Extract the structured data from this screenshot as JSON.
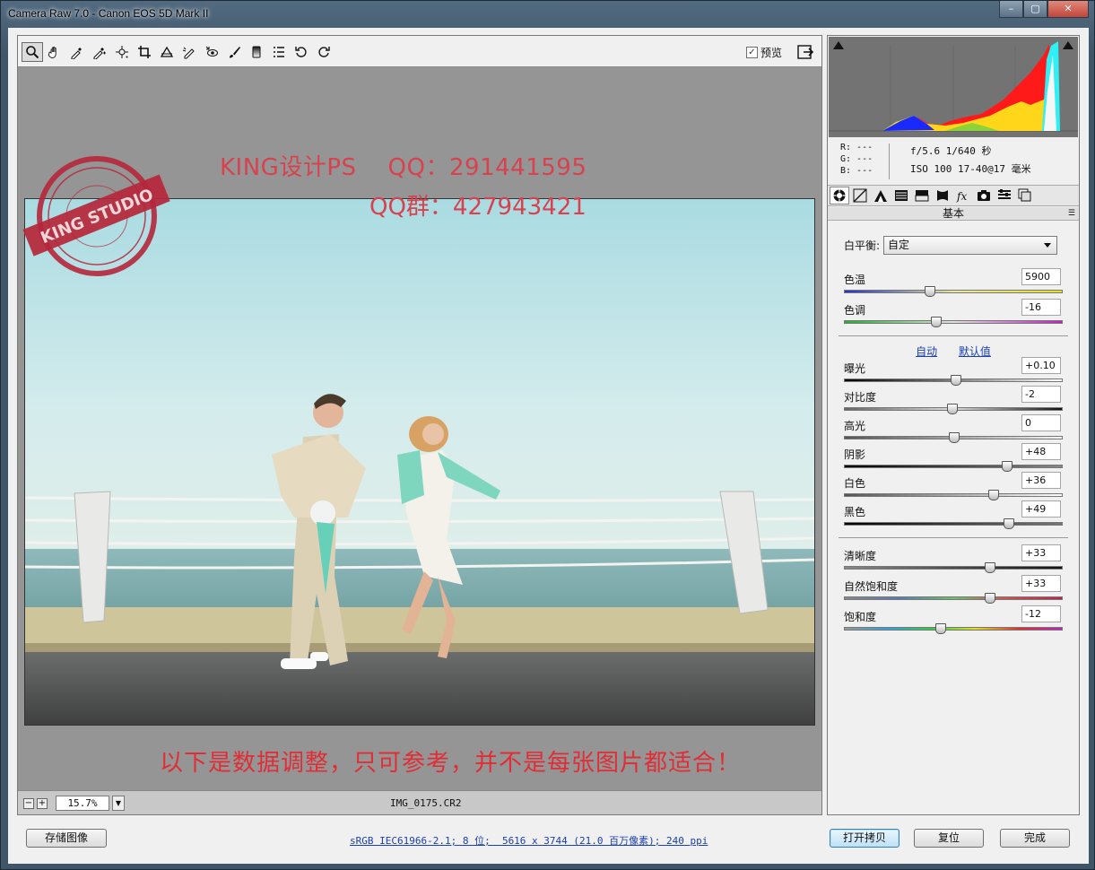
{
  "window": {
    "title": "Camera Raw 7.0 -  Canon EOS 5D Mark II",
    "minimize": "–",
    "maximize": "▢",
    "close": "✕"
  },
  "toolbar": {
    "tools": [
      "zoom-tool-icon",
      "hand-tool-icon",
      "white-balance-tool-icon",
      "color-sampler-tool-icon",
      "targeted-adjustment-tool-icon",
      "crop-tool-icon",
      "straighten-tool-icon",
      "spot-removal-tool-icon",
      "red-eye-removal-tool-icon",
      "adjustment-brush-icon",
      "graduated-filter-icon",
      "preferences-icon",
      "rotate-ccw-icon",
      "rotate-cw-icon"
    ],
    "preview_label": "预览",
    "preview_checked": "✓"
  },
  "canvas": {
    "watermark_line1": "KING设计PS    QQ：291441595",
    "watermark_line2": "QQ群：427943421",
    "note": "以下是数据调整，只可参考，并不是每张图片都适合！",
    "stamp_text": "KING STUDIO"
  },
  "status": {
    "zoom": "15.7%",
    "zoom_out": "−",
    "zoom_in": "+",
    "zoom_dropdown": "▼",
    "filename": "IMG_0175.CR2"
  },
  "info": {
    "r": "R:  ---",
    "g": "G:  ---",
    "b": "B:  ---",
    "aperture_shutter": "f/5.6   1/640 秒",
    "iso_lens": "ISO 100   17-40@17 毫米"
  },
  "panel": {
    "title": "基本",
    "menu_icon": "☰",
    "wb_label": "白平衡:",
    "wb_value": "自定",
    "auto_link": "自动",
    "default_link": "默认值",
    "sliders": [
      {
        "label": "色温",
        "value": "5900",
        "pos": 0.39
      },
      {
        "label": "色调",
        "value": "-16",
        "pos": 0.42
      },
      {
        "label": "曝光",
        "value": "+0.10",
        "pos": 0.51
      },
      {
        "label": "对比度",
        "value": "-2",
        "pos": 0.49
      },
      {
        "label": "高光",
        "value": "0",
        "pos": 0.5
      },
      {
        "label": "阴影",
        "value": "+48",
        "pos": 0.74
      },
      {
        "label": "白色",
        "value": "+36",
        "pos": 0.68
      },
      {
        "label": "黑色",
        "value": "+49",
        "pos": 0.75
      },
      {
        "label": "清晰度",
        "value": "+33",
        "pos": 0.665
      },
      {
        "label": "自然饱和度",
        "value": "+33",
        "pos": 0.665
      },
      {
        "label": "饱和度",
        "value": "-12",
        "pos": 0.44
      }
    ]
  },
  "bottom": {
    "save_label": "存储图像",
    "workflow": "sRGB IEC61966-2.1; 8 位;  5616 x 3744 (21.0 百万像素); 240 ppi",
    "open_label": "打开拷贝",
    "reset_label": "复位",
    "done_label": "完成"
  },
  "colors": {
    "watermark": "#d8424e",
    "note": "#e12d35",
    "link": "#1a3fb0"
  }
}
